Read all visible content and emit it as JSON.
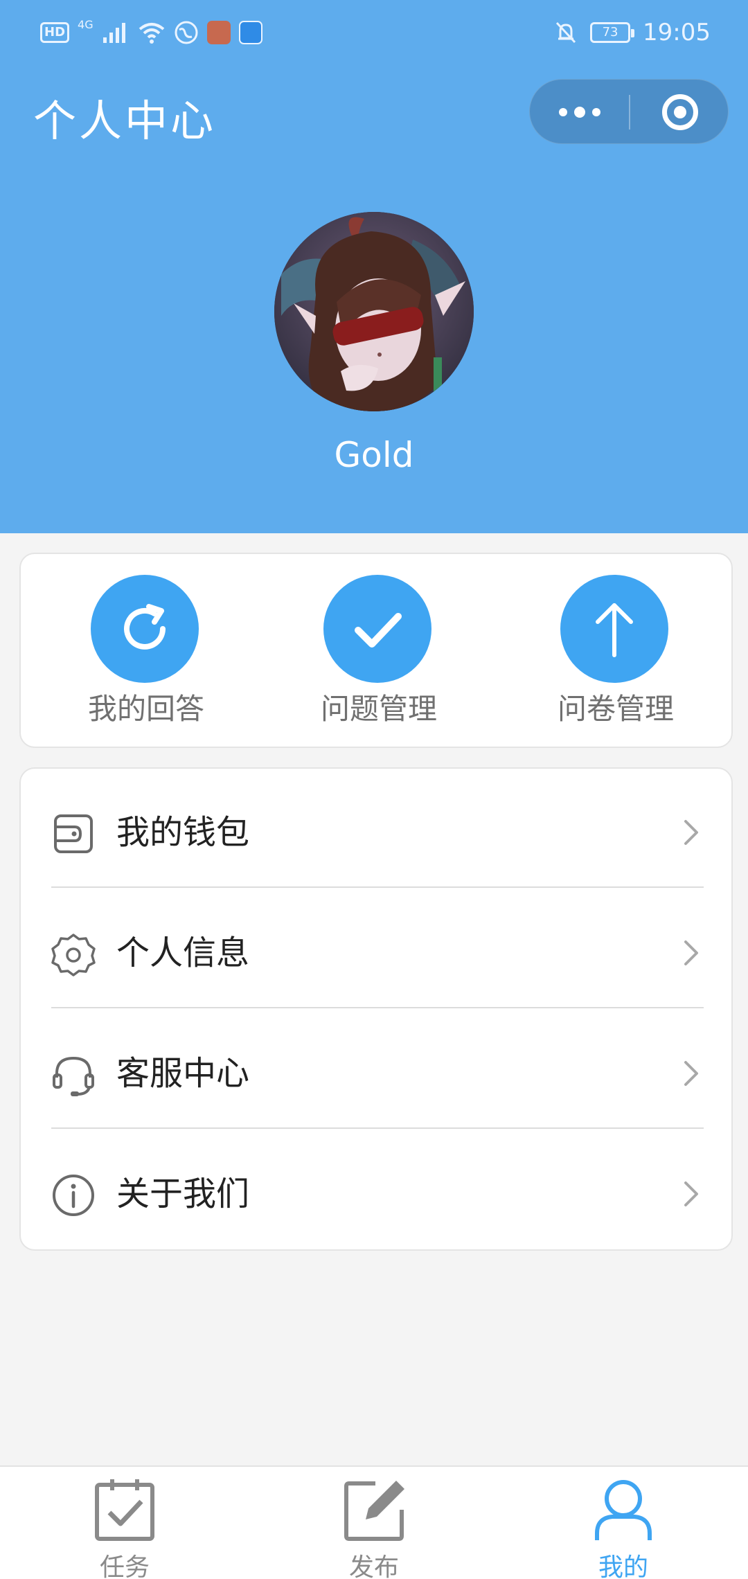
{
  "status_bar": {
    "hd": "HD",
    "network": "4G",
    "battery": "73",
    "time": "19:05"
  },
  "header": {
    "title": "个人中心"
  },
  "profile": {
    "username": "Gold"
  },
  "quick_actions": [
    {
      "label": "我的回答",
      "icon": "refresh-icon"
    },
    {
      "label": "问题管理",
      "icon": "check-icon"
    },
    {
      "label": "问卷管理",
      "icon": "arrow-up-icon"
    }
  ],
  "menu": [
    {
      "label": "我的钱包",
      "icon": "wallet-icon"
    },
    {
      "label": "个人信息",
      "icon": "gear-icon"
    },
    {
      "label": "客服中心",
      "icon": "headset-icon"
    },
    {
      "label": "关于我们",
      "icon": "info-icon"
    }
  ],
  "tabbar": [
    {
      "label": "任务",
      "icon": "task-icon",
      "active": false
    },
    {
      "label": "发布",
      "icon": "edit-icon",
      "active": false
    },
    {
      "label": "我的",
      "icon": "user-icon",
      "active": true
    }
  ],
  "colors": {
    "header_bg": "#5eaced",
    "accent": "#3fa5f2",
    "page_bg": "#f4f4f4",
    "text_dark": "#222222",
    "text_gray": "#707070"
  }
}
